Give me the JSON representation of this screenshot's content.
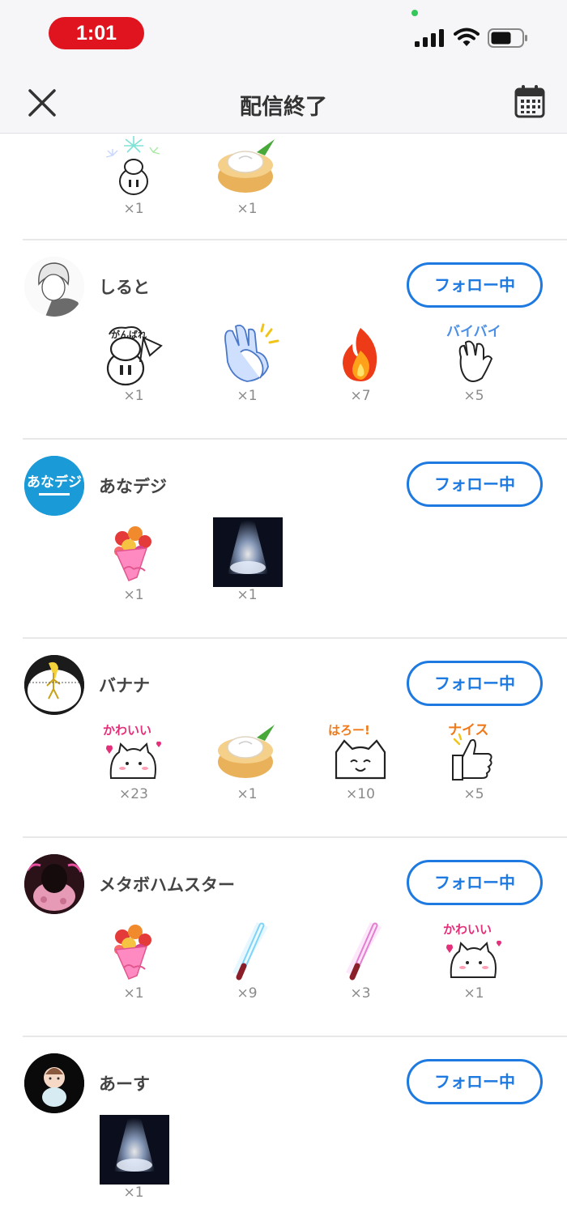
{
  "status_bar": {
    "time": "1:01"
  },
  "header": {
    "title": "配信終了"
  },
  "top_gifts": [
    {
      "icon": "fireworks-pig-icon",
      "count": "×1"
    },
    {
      "icon": "nikuman-icon",
      "count": "×1"
    }
  ],
  "users": [
    {
      "name": "しると",
      "follow_label": "フォロー中",
      "avatar": "anime-boy-avatar",
      "gifts": [
        {
          "icon": "ganbare-pig-icon",
          "count": "×1"
        },
        {
          "icon": "clapping-hands-icon",
          "count": "×1"
        },
        {
          "icon": "flame-icon",
          "count": "×7"
        },
        {
          "icon": "byebye-hand-icon",
          "count": "×5"
        }
      ]
    },
    {
      "name": "あなデジ",
      "follow_label": "フォロー中",
      "avatar": "anadeji-logo-avatar",
      "avatar_text": "あなデジ",
      "gifts": [
        {
          "icon": "bouquet-icon",
          "count": "×1"
        },
        {
          "icon": "spotlight-icon",
          "count": "×1"
        }
      ]
    },
    {
      "name": "バナナ",
      "follow_label": "フォロー中",
      "avatar": "banana-avatar",
      "gifts": [
        {
          "icon": "kawaii-cat-icon",
          "count": "×23",
          "caption": "かわいい"
        },
        {
          "icon": "nikuman-icon",
          "count": "×1"
        },
        {
          "icon": "hello-cat-icon",
          "count": "×10",
          "caption": "はろー!"
        },
        {
          "icon": "nice-thumb-icon",
          "count": "×5",
          "caption": "ナイス"
        }
      ]
    },
    {
      "name": "メタボハムスター",
      "follow_label": "フォロー中",
      "avatar": "hamster-avatar",
      "gifts": [
        {
          "icon": "bouquet-icon",
          "count": "×1"
        },
        {
          "icon": "blue-glowstick-icon",
          "count": "×9"
        },
        {
          "icon": "pink-glowstick-icon",
          "count": "×3"
        },
        {
          "icon": "kawaii-cat-icon",
          "count": "×1",
          "caption": "かわいい"
        }
      ]
    },
    {
      "name": "あーす",
      "follow_label": "フォロー中",
      "avatar": "baby-avatar",
      "gifts": [
        {
          "icon": "spotlight-icon",
          "count": "×1"
        }
      ]
    }
  ],
  "colors": {
    "accent": "#1e7ae0",
    "time_pill": "#e0141f",
    "divider": "#e8e8e8"
  }
}
